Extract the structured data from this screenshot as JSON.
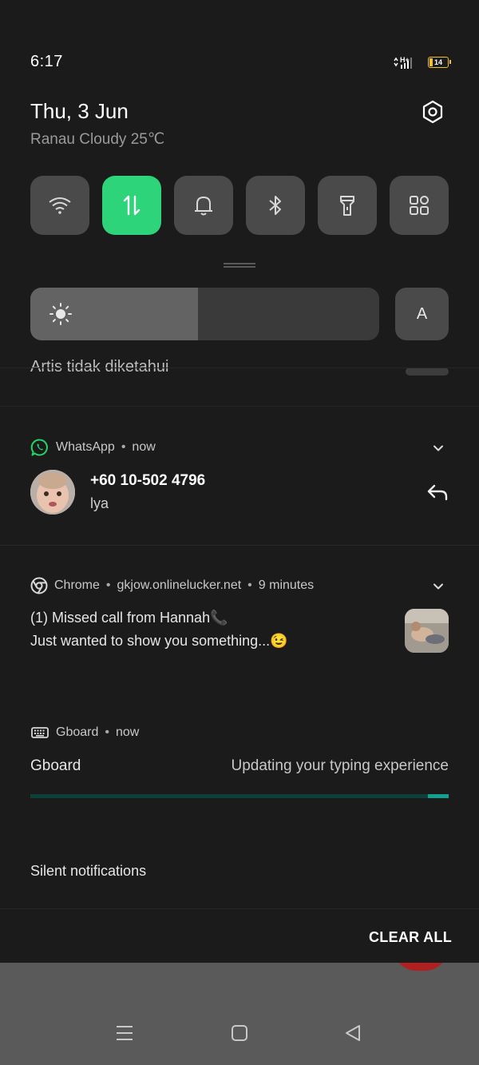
{
  "status_bar": {
    "time": "6:17",
    "network": "H+",
    "battery_level": "14"
  },
  "header": {
    "date": "Thu, 3 Jun",
    "weather": "Ranau Cloudy 25℃"
  },
  "quick_tiles": [
    {
      "name": "wifi",
      "icon": "wifi-icon",
      "active": false
    },
    {
      "name": "mobile-data",
      "icon": "data-arrows-icon",
      "active": true
    },
    {
      "name": "sound",
      "icon": "bell-icon",
      "active": false
    },
    {
      "name": "bluetooth",
      "icon": "bluetooth-icon",
      "active": false
    },
    {
      "name": "flashlight",
      "icon": "flashlight-icon",
      "active": false
    },
    {
      "name": "more",
      "icon": "grid-icon",
      "active": false
    }
  ],
  "brightness": {
    "level_percent": 48,
    "auto_label": "A"
  },
  "peek_notification": {
    "text": "Artis tidak diketahui"
  },
  "notifications": {
    "whatsapp": {
      "app": "WhatsApp",
      "time": "now",
      "title": "+60 10-502 4796",
      "text": "lya"
    },
    "chrome": {
      "app": "Chrome",
      "site": "gkjow.onlinelucker.net",
      "time": "9 minutes",
      "line1": "(1) Missed call from Hannah📞",
      "line2": "Just wanted to show you something...😉"
    },
    "gboard": {
      "app": "Gboard",
      "time": "now",
      "title": "Gboard",
      "status": "Updating your typing experience",
      "progress_percent": 5
    }
  },
  "silent_section": {
    "label": "Silent notifications"
  },
  "footer": {
    "clear_all": "CLEAR ALL"
  },
  "colors": {
    "accent": "#2ed47a",
    "tile_bg": "#4a4a4a",
    "progress": "#13a08e",
    "whatsapp": "#25d366"
  }
}
